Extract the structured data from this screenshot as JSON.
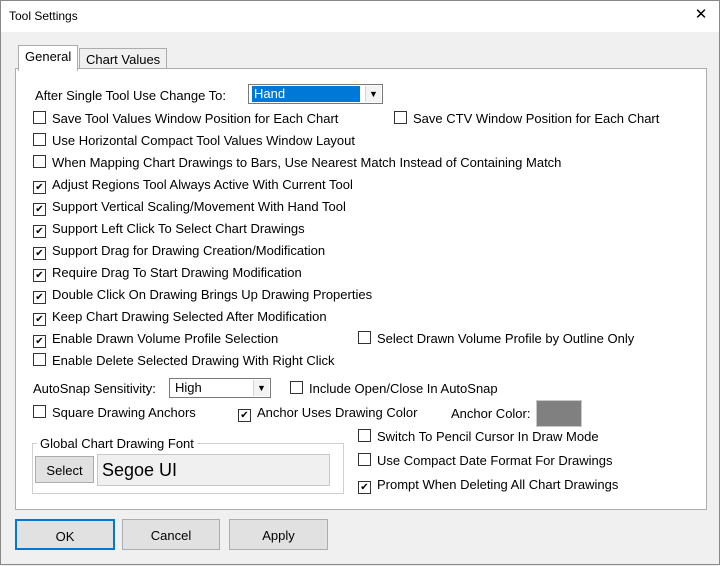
{
  "window": {
    "title": "Tool Settings",
    "close_glyph": "✕"
  },
  "tabs": [
    {
      "label": "General"
    },
    {
      "label": "Chart Values"
    }
  ],
  "general": {
    "after_single_label": "After Single Tool Use Change To:",
    "after_single_value": "Hand",
    "checks": [
      {
        "label": "Save Tool Values Window Position for Each Chart",
        "checked": false
      },
      {
        "label": "Save CTV Window Position for Each Chart",
        "checked": false
      },
      {
        "label": "Use Horizontal Compact Tool Values Window Layout",
        "checked": false
      },
      {
        "label": "When Mapping Chart Drawings to Bars, Use Nearest Match Instead of Containing Match",
        "checked": false
      },
      {
        "label": "Adjust Regions Tool Always Active With Current Tool",
        "checked": true
      },
      {
        "label": "Support Vertical Scaling/Movement With Hand Tool",
        "checked": true
      },
      {
        "label": "Support Left Click To Select Chart Drawings",
        "checked": true
      },
      {
        "label": "Support Drag for Drawing Creation/Modification",
        "checked": true
      },
      {
        "label": "Require Drag To Start Drawing Modification",
        "checked": true
      },
      {
        "label": "Double Click On Drawing Brings Up Drawing Properties",
        "checked": true
      },
      {
        "label": "Keep Chart Drawing Selected After Modification",
        "checked": true
      },
      {
        "label": "Enable Drawn Volume Profile Selection",
        "checked": true
      },
      {
        "label": "Select Drawn Volume Profile by Outline Only",
        "checked": false
      },
      {
        "label": "Enable Delete Selected Drawing With Right Click",
        "checked": false
      }
    ],
    "autosnap_label": "AutoSnap Sensitivity:",
    "autosnap_value": "High",
    "include_openclose": {
      "label": "Include Open/Close In AutoSnap",
      "checked": false
    },
    "square_anchors": {
      "label": "Square Drawing Anchors",
      "checked": false
    },
    "anchor_uses_color": {
      "label": "Anchor Uses Drawing Color",
      "checked": true
    },
    "anchor_color_label": "Anchor Color:",
    "anchor_color": "#808080",
    "font_group_label": "Global Chart Drawing Font",
    "select_button": "Select",
    "font_name": "Segoe UI",
    "pencil_cursor": {
      "label": "Switch To Pencil Cursor In Draw Mode",
      "checked": false
    },
    "compact_date": {
      "label": "Use Compact Date Format For Drawings",
      "checked": false
    },
    "prompt_delete": {
      "label": "Prompt When Deleting All Chart Drawings",
      "checked": true
    }
  },
  "footer": {
    "ok": "OK",
    "cancel": "Cancel",
    "apply": "Apply"
  },
  "check_glyph": "✔",
  "colors": {
    "selection": "#0078d7",
    "combo_border": "#7a7a7a"
  }
}
